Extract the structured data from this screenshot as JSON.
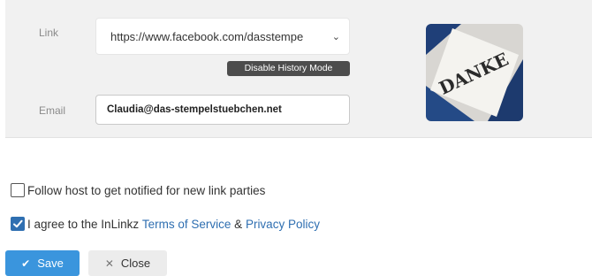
{
  "form": {
    "link_label": "Link",
    "link_value": "https://www.facebook.com/dasstempe",
    "history_button": "Disable History Mode",
    "email_label": "Email",
    "email_value": "Claudia@das-stempelstuebchen.net",
    "thumbnail_text": "DANKE"
  },
  "options": {
    "follow_label": "Follow host to get notified for new link parties",
    "follow_checked": false,
    "agree_prefix": "I agree to the InLinkz",
    "terms_link": "Terms of Service",
    "amp": "&",
    "privacy_link": "Privacy Policy",
    "agree_checked": true
  },
  "actions": {
    "save_label": "Save",
    "close_label": "Close"
  },
  "colors": {
    "accent": "#3a95dd",
    "link": "#2f6fb1"
  }
}
